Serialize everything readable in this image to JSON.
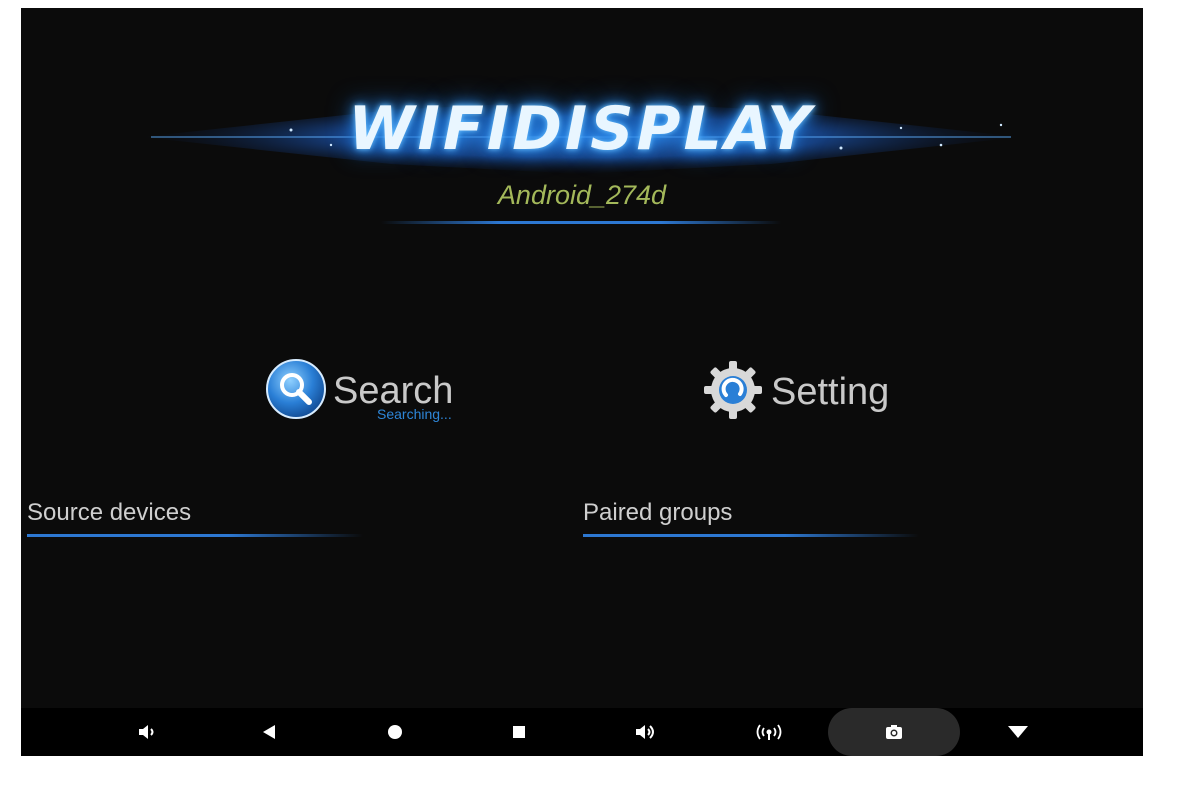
{
  "app": {
    "logo_text": "WIFIDISPLAY",
    "device_name": "Android_274d"
  },
  "actions": {
    "search": {
      "label": "Search",
      "status": "Searching...",
      "icon": "search-icon"
    },
    "setting": {
      "label": "Setting",
      "icon": "gear-icon"
    }
  },
  "sections": {
    "source_devices": "Source devices",
    "paired_groups": "Paired groups"
  },
  "navbar": {
    "items": [
      {
        "name": "volume-down-icon"
      },
      {
        "name": "back-icon"
      },
      {
        "name": "home-icon"
      },
      {
        "name": "recents-icon"
      },
      {
        "name": "volume-up-icon"
      },
      {
        "name": "wifi-display-icon"
      },
      {
        "name": "screenshot-icon"
      },
      {
        "name": "hide-navbar-icon"
      }
    ]
  },
  "colors": {
    "background": "#0b0b0b",
    "accent_blue": "#2d78d2",
    "device_name": "#a3b85a",
    "status_blue": "#2e86d8"
  }
}
